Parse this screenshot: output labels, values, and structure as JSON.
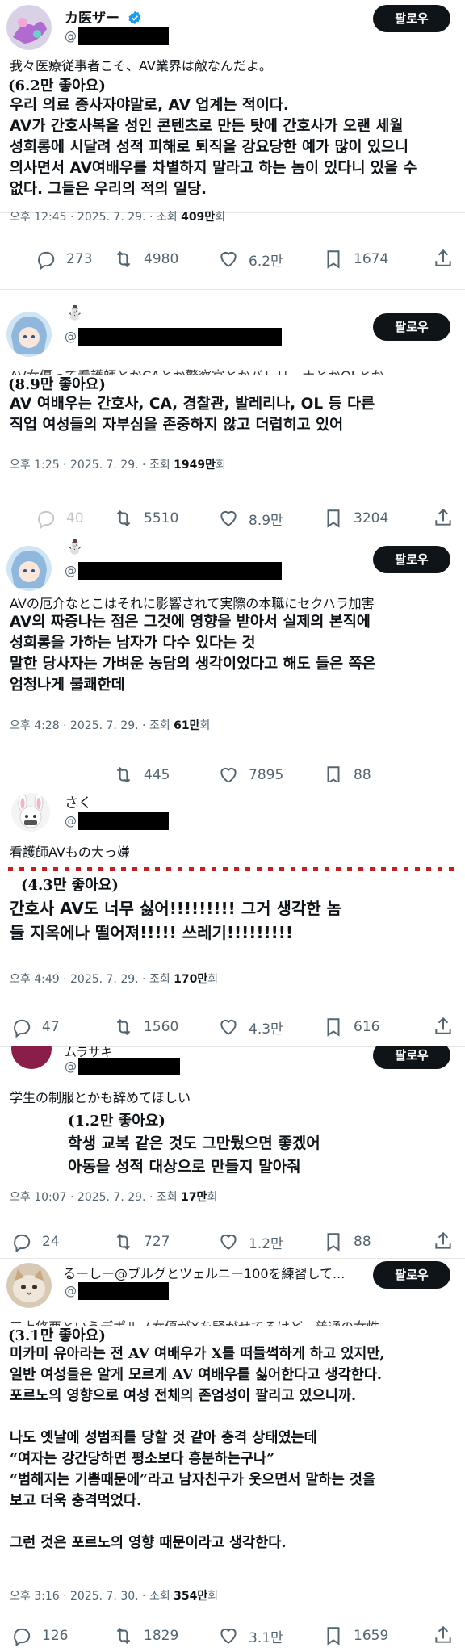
{
  "ui": {
    "follow_label": "팔로우"
  },
  "posts": [
    {
      "name": "カ医ザー",
      "at": "@",
      "original": "我々医療従事者こそ、AV業界は敵なんだよ。",
      "likes_badge": "(6.2만 좋아요)",
      "translation": [
        "우리 의료 종사자야말로, AV 업계는 적이다.",
        "AV가 간호사복을 성인 콘텐츠로 만든 탓에 간호사가 오랜 세월",
        "성희롱에 시달려 성적 피해로 퇴직을 강요당한 예가 많이 있으니",
        "의사면서 AV여배우를 차별하지 말라고 하는 놈이 있다니 있을 수",
        "없다. 그들은 우리의 적의 일당."
      ],
      "time": "오후 12:45 · 2025. 7. 29. · 조회 ",
      "views": "409만",
      "views_unit": "회",
      "replies": "273",
      "reposts": "4980",
      "like_count": "6.2만",
      "bookmarks": "1674"
    },
    {
      "name": "⛄",
      "at": "@",
      "original": "AV女優って看護師とかCAとか警察官とかバレリーナとかOLとか",
      "likes_badge": "(8.9만 좋아요)",
      "translation": [
        "AV 여배우는 간호사, CA, 경찰관, 발레리나, OL 등 다른",
        "직업 여성들의 자부심을 존중하지 않고 더럽히고 있어"
      ],
      "time": "오후 1:25 · 2025. 7. 29. · 조회 ",
      "views": "1949만",
      "views_unit": "회",
      "replies": "40",
      "reposts": "5510",
      "like_count": "8.9만",
      "bookmarks": "3204"
    },
    {
      "name": "⛄",
      "at": "@",
      "original": "AVの厄介なとこはそれに影響されて実際の本職にセクハラ加害",
      "translation": [
        "AV의 짜증나는 점은 그것에 영향을 받아서 실제의 본직에",
        "성희롱을 가하는 남자가 다수 있다는 것",
        "말한 당사자는 가벼운 농담의 생각이었다고 해도 들은 쪽은",
        "엄청나게 불쾌한데"
      ],
      "time": "오후 4:28 · 2025. 7. 29. · 조회 ",
      "views": "61만",
      "views_unit": "회",
      "reposts": "445",
      "like_count": "7895",
      "bookmarks": "88"
    },
    {
      "name": "さく",
      "at": "@",
      "original": "看護師AVもの大っ嫌",
      "likes_badge": "(4.3만 좋아요)",
      "translation": [
        "간호사 AV도 너무 싫어!!!!!!!!! 그거 생각한 놈",
        "들 지옥에나 떨어져!!!!! 쓰레기!!!!!!!!!"
      ],
      "time": "오후 4:49 · 2025. 7. 29. · 조회 ",
      "views": "170만",
      "views_unit": "회",
      "replies": "47",
      "reposts": "1560",
      "like_count": "4.3만",
      "bookmarks": "616"
    },
    {
      "name": "ムラサキ",
      "at": "@",
      "original": "学生の制服とかも辞めてほしい",
      "likes_badge": "(1.2만 좋아요)",
      "translation": [
        "학생 교복 같은 것도 그만뒀으면 좋겠어",
        "아동을 성적 대상으로 만들지 말아줘"
      ],
      "time": "오후 10:07 · 2025. 7. 29. · 조회 ",
      "views": "17만",
      "views_unit": "회",
      "replies": "24",
      "reposts": "727",
      "like_count": "1.2만",
      "bookmarks": "88"
    },
    {
      "name": "るーしー@ブルグとツェルニー100を練習して...",
      "at": "@",
      "original": "三上悠亜というデポルノ女優がXを騒がせてるけど、普通の女性",
      "likes_badge": "(3.1만 좋아요)",
      "translation": [
        "미카미 유아라는 전 AV 여배우가 X를 떠들썩하게 하고 있지만,",
        "일반 여성들은 알게 모르게 AV 여배우를 싫어한다고 생각한다.",
        "포르노의 영향으로 여성 전체의 존엄성이 팔리고 있으니까.",
        "",
        "나도 옛날에 성범죄를 당할 것 같아 충격 상태였는데",
        "“여자는 강간당하면 평소보다 흥분하는구나”",
        "“범해지는 기쁨때문에”라고 남자친구가 웃으면서 말하는 것을",
        "보고 더욱 충격먹었다.",
        "",
        "그런 것은 포르노의 영향 때문이라고 생각한다."
      ],
      "time": "오후 3:16 · 2025. 7. 30. · 조회 ",
      "views": "354만",
      "views_unit": "회",
      "replies": "126",
      "reposts": "1829",
      "like_count": "3.1만",
      "bookmarks": "1659"
    }
  ]
}
